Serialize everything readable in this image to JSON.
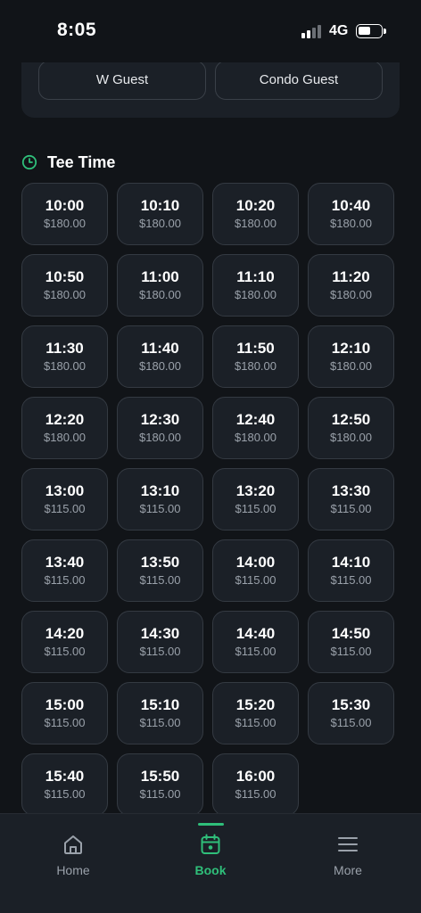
{
  "status_bar": {
    "time": "8:05",
    "network": "4G",
    "icons": [
      "signal-icon",
      "battery-icon"
    ]
  },
  "guest_options": {
    "w_guest": "W Guest",
    "condo_guest": "Condo Guest"
  },
  "tee_time": {
    "title": "Tee Time",
    "icon": "clock-icon",
    "accent_color": "#2fbf7a",
    "slots": [
      {
        "time": "10:00",
        "price": "$180.00"
      },
      {
        "time": "10:10",
        "price": "$180.00"
      },
      {
        "time": "10:20",
        "price": "$180.00"
      },
      {
        "time": "10:40",
        "price": "$180.00"
      },
      {
        "time": "10:50",
        "price": "$180.00"
      },
      {
        "time": "11:00",
        "price": "$180.00"
      },
      {
        "time": "11:10",
        "price": "$180.00"
      },
      {
        "time": "11:20",
        "price": "$180.00"
      },
      {
        "time": "11:30",
        "price": "$180.00"
      },
      {
        "time": "11:40",
        "price": "$180.00"
      },
      {
        "time": "11:50",
        "price": "$180.00"
      },
      {
        "time": "12:10",
        "price": "$180.00"
      },
      {
        "time": "12:20",
        "price": "$180.00"
      },
      {
        "time": "12:30",
        "price": "$180.00"
      },
      {
        "time": "12:40",
        "price": "$180.00"
      },
      {
        "time": "12:50",
        "price": "$180.00"
      },
      {
        "time": "13:00",
        "price": "$115.00"
      },
      {
        "time": "13:10",
        "price": "$115.00"
      },
      {
        "time": "13:20",
        "price": "$115.00"
      },
      {
        "time": "13:30",
        "price": "$115.00"
      },
      {
        "time": "13:40",
        "price": "$115.00"
      },
      {
        "time": "13:50",
        "price": "$115.00"
      },
      {
        "time": "14:00",
        "price": "$115.00"
      },
      {
        "time": "14:10",
        "price": "$115.00"
      },
      {
        "time": "14:20",
        "price": "$115.00"
      },
      {
        "time": "14:30",
        "price": "$115.00"
      },
      {
        "time": "14:40",
        "price": "$115.00"
      },
      {
        "time": "14:50",
        "price": "$115.00"
      },
      {
        "time": "15:00",
        "price": "$115.00"
      },
      {
        "time": "15:10",
        "price": "$115.00"
      },
      {
        "time": "15:20",
        "price": "$115.00"
      },
      {
        "time": "15:30",
        "price": "$115.00"
      },
      {
        "time": "15:40",
        "price": "$115.00"
      },
      {
        "time": "15:50",
        "price": "$115.00"
      },
      {
        "time": "16:00",
        "price": "$115.00"
      }
    ]
  },
  "bottom_nav": {
    "active": "Book",
    "items": [
      {
        "label": "Home",
        "icon": "home-icon"
      },
      {
        "label": "Book",
        "icon": "calendar-icon"
      },
      {
        "label": "More",
        "icon": "menu-icon"
      }
    ]
  },
  "colors": {
    "background": "#111418",
    "card": "#1b2027",
    "accent": "#2fbf7a",
    "muted_text": "#9aa1aa"
  }
}
